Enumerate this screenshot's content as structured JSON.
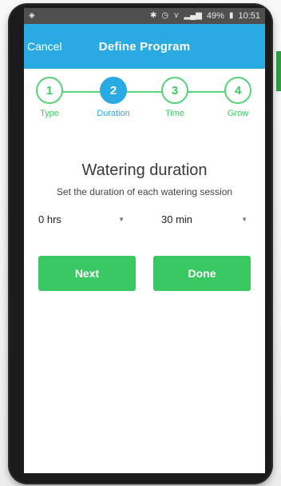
{
  "status_bar": {
    "left_icon": "app-notification-icon",
    "icons": [
      "bluetooth-icon",
      "clock-icon",
      "wifi-icon",
      "signal-icon"
    ],
    "battery_percent": "49%",
    "time": "10:51"
  },
  "header": {
    "cancel_label": "Cancel",
    "title": "Define Program"
  },
  "stepper": {
    "steps": [
      {
        "number": "1",
        "label": "Type",
        "active": false
      },
      {
        "number": "2",
        "label": "Duration",
        "active": true
      },
      {
        "number": "3",
        "label": "Time",
        "active": false
      },
      {
        "number": "4",
        "label": "Grow",
        "active": false
      }
    ]
  },
  "content": {
    "title": "Watering duration",
    "subtitle": "Set the duration of each watering session",
    "hours_value": "0 hrs",
    "minutes_value": "30 min"
  },
  "buttons": {
    "next_label": "Next",
    "done_label": "Done"
  },
  "colors": {
    "header": "#29aae2",
    "accent_green": "#39c862",
    "active_step": "#29aae2"
  }
}
